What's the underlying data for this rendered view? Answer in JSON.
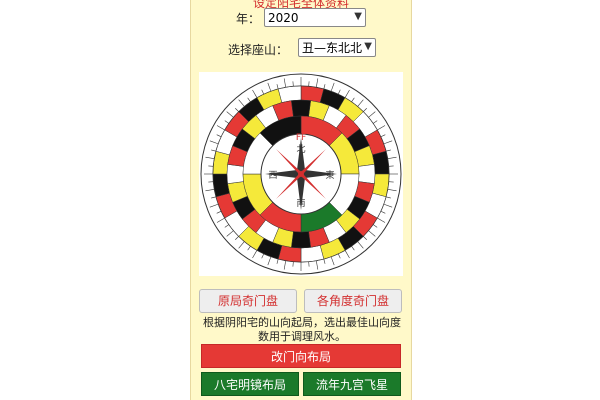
{
  "header": {
    "title": "设定阳宅全体资料"
  },
  "year": {
    "label": "年：",
    "value": "2020"
  },
  "mountain": {
    "label": "选择座山：",
    "value": "丑—东北北"
  },
  "compass": {
    "center_top": "北",
    "center_right": "東",
    "center_bottom": "南",
    "center_left": "西",
    "logo": "FF"
  },
  "buttons": {
    "original_panel": "原局奇门盘",
    "angle_panel": "各角度奇门盘"
  },
  "description": "根据阴阳宅的山向起局，选出最佳山向度数用于调理风水。",
  "actions": {
    "change_door": "改门向布局",
    "bazhai": "八宅明镜布局",
    "flying_star": "流年九宫飞星"
  },
  "colors": {
    "panel_bg": "#fff9c9",
    "red": "#e53935",
    "green": "#1b7a2a"
  }
}
